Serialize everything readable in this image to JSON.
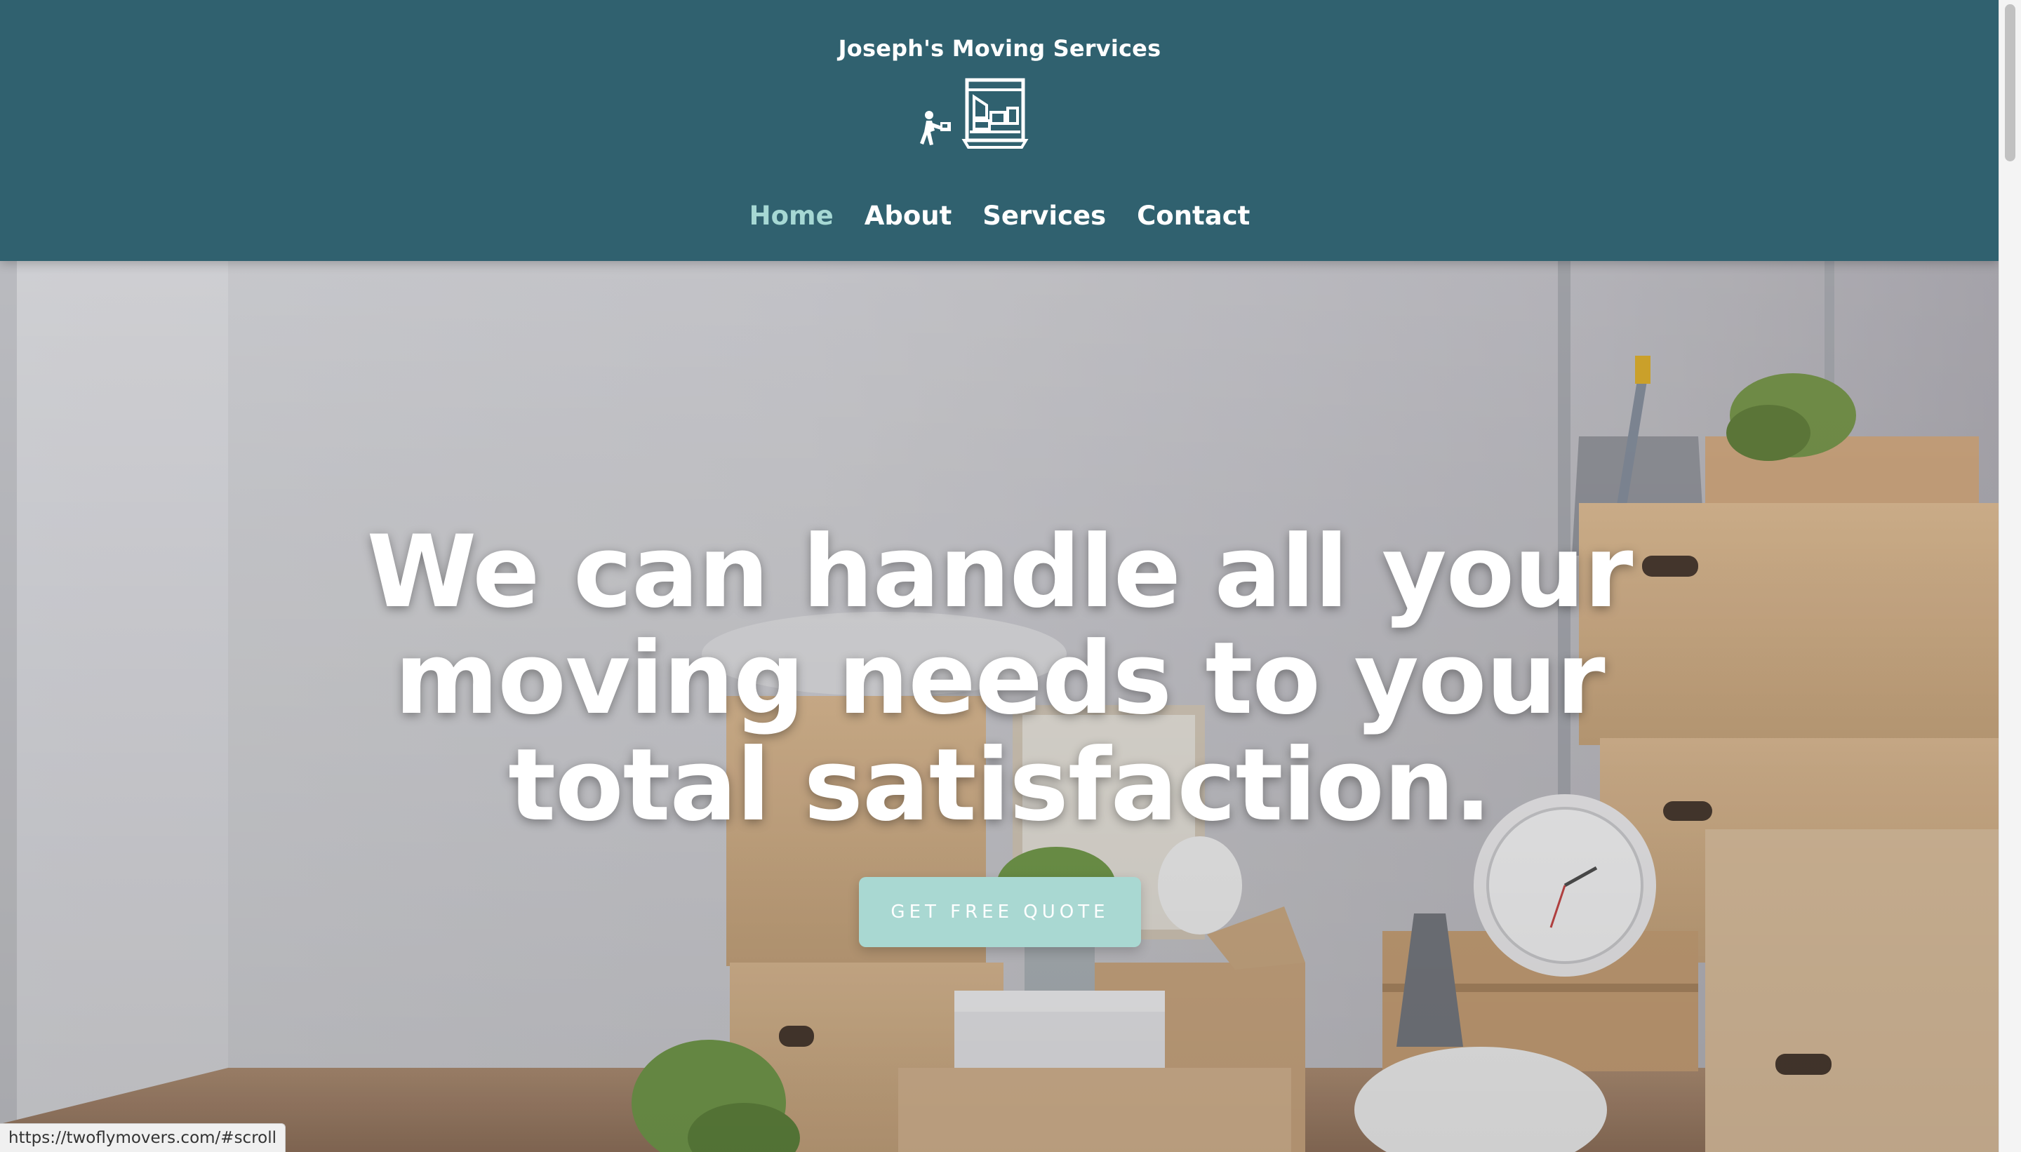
{
  "header": {
    "site_title": "Joseph's Moving Services",
    "logo_icon": "mover-with-truck-icon",
    "nav": [
      {
        "label": "Home",
        "active": true
      },
      {
        "label": "About",
        "active": false
      },
      {
        "label": "Services",
        "active": false
      },
      {
        "label": "Contact",
        "active": false
      }
    ],
    "background_color": "#30616f",
    "active_link_color": "#a6d8d4"
  },
  "hero": {
    "headline_lines": [
      "We can handle all your",
      "moving needs to your",
      "total satisfaction."
    ],
    "cta_label": "GET FREE QUOTE",
    "cta_color": "#a9d8d2",
    "background_image": "room-with-stacked-moving-boxes-and-plants"
  },
  "browser": {
    "status_url": "https://twoflymovers.com/#scroll"
  }
}
